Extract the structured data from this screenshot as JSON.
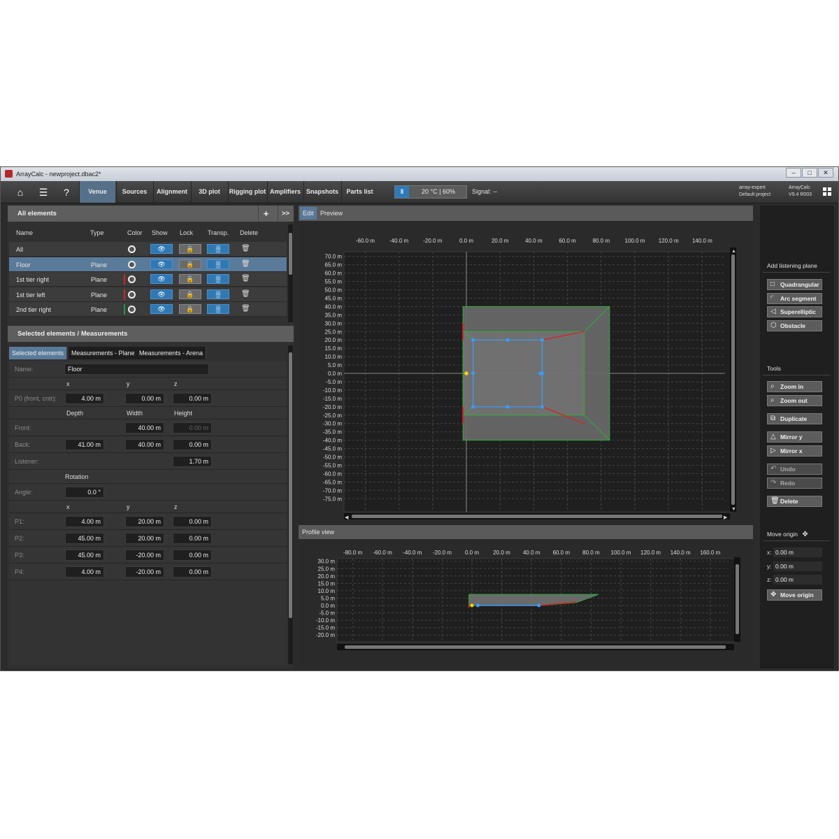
{
  "window": {
    "title": "ArrayCalc - newproject.dbac2*",
    "min": "–",
    "max": "□",
    "close": "✕"
  },
  "toolbar": {
    "tabs": [
      "Venue",
      "Sources",
      "Alignment",
      "3D plot",
      "Rigging plot",
      "Amplifiers",
      "Snapshots",
      "Parts list"
    ],
    "active_tab": "Venue",
    "temp_icon": "‖",
    "temp": "20 °C | 60%",
    "signal": "Signal: --",
    "expert_1": "array-expert",
    "expert_2": "Default project",
    "ver_1": "ArrayCalc",
    "ver_2": "V9.4 R003"
  },
  "all_elements": {
    "title": "All elements",
    "add": "+",
    "expand": ">>",
    "columns": [
      "Name",
      "Type",
      "Color",
      "Show",
      "Lock",
      "Transp.",
      "Delete"
    ],
    "rows": [
      {
        "name": "All",
        "type": "",
        "color": ""
      },
      {
        "name": "Floor",
        "type": "Plane",
        "color": ""
      },
      {
        "name": "1st tier right",
        "type": "Plane",
        "color": "#d0272b"
      },
      {
        "name": "1st tier left",
        "type": "Plane",
        "color": "#d0272b"
      },
      {
        "name": "2nd tier right",
        "type": "Plane",
        "color": "#1e9b3a"
      }
    ],
    "show_glyph": "👁",
    "lock_glyph": "🔒",
    "transp_glyph": "▒",
    "delete_glyph": "🗑"
  },
  "selected": {
    "title": "Selected elements / Measurements",
    "tabs": [
      "Selected elements",
      "Measurements - Plane",
      "Measurements - Arena"
    ],
    "name_label": "Name:",
    "name_value": "Floor",
    "h_x": "x",
    "h_y": "y",
    "h_z": "z",
    "p0_label": "P0 (front, cntr):",
    "p0": [
      "4.00 m",
      "0.00 m",
      "0.00 m"
    ],
    "h_depth": "Depth",
    "h_width": "Width",
    "h_height": "Height",
    "front_label": "Front:",
    "front": [
      "",
      "40.00 m",
      "0.00 m"
    ],
    "back_label": "Back:",
    "back": [
      "41.00 m",
      "40.00 m",
      "0.00 m"
    ],
    "listener_label": "Listener:",
    "listener": "1.70 m",
    "rotation": "Rotation",
    "angle_label": "Angle:",
    "angle": "0.0 °",
    "points": [
      {
        "label": "P1:",
        "v": [
          "4.00 m",
          "20.00 m",
          "0.00 m"
        ]
      },
      {
        "label": "P2:",
        "v": [
          "45.00 m",
          "20.00 m",
          "0.00 m"
        ]
      },
      {
        "label": "P3:",
        "v": [
          "45.00 m",
          "-20.00 m",
          "0.00 m"
        ]
      },
      {
        "label": "P4:",
        "v": [
          "4.00 m",
          "-20.00 m",
          "0.00 m"
        ]
      }
    ]
  },
  "center": {
    "tab_edit": "Edit",
    "tab_preview": "Preview",
    "profile_title": "Profile view",
    "top_x_ticks": [
      "-60.0 m",
      "-40.0 m",
      "-20.0 m",
      "0.0 m",
      "20.0 m",
      "40.0 m",
      "60.0 m",
      "80.0 m",
      "100.0 m",
      "120.0 m",
      "140.0 m"
    ],
    "top_y_ticks": [
      "70.0 m",
      "65.0 m",
      "60.0 m",
      "55.0 m",
      "50.0 m",
      "45.0 m",
      "40.0 m",
      "35.0 m",
      "30.0 m",
      "25.0 m",
      "20.0 m",
      "15.0 m",
      "10.0 m",
      "5.0 m",
      "0.0 m",
      "-5.0 m",
      "-10.0 m",
      "-15.0 m",
      "-20.0 m",
      "-25.0 m",
      "-30.0 m",
      "-35.0 m",
      "-40.0 m",
      "-45.0 m",
      "-50.0 m",
      "-55.0 m",
      "-60.0 m",
      "-65.0 m",
      "-70.0 m",
      "-75.0 m"
    ],
    "prof_x_ticks": [
      "-80.0 m",
      "-60.0 m",
      "-40.0 m",
      "-20.0 m",
      "0.0 m",
      "20.0 m",
      "40.0 m",
      "60.0 m",
      "80.0 m",
      "100.0 m",
      "120.0 m",
      "140.0 m",
      "160.0 m"
    ],
    "prof_y_ticks": [
      "30.0 m",
      "25.0 m",
      "20.0 m",
      "15.0 m",
      "10.0 m",
      "5.0 m",
      "0.0 m",
      "-5.0 m",
      "-10.0 m",
      "-15.0 m",
      "-20.0 m"
    ]
  },
  "right": {
    "add_plane": "Add listening plane",
    "plane_buttons": [
      {
        "label": "Quadrangular",
        "icon": "□"
      },
      {
        "label": "Arc segment",
        "icon": "◜"
      },
      {
        "label": "Superelliptic",
        "icon": "◁"
      },
      {
        "label": "Obstacle",
        "icon": "⬡"
      }
    ],
    "tools": "Tools",
    "tool_buttons": [
      {
        "label": "Zoom in",
        "icon": "⌕"
      },
      {
        "label": "Zoom out",
        "icon": "⌕"
      },
      {
        "label": "Duplicate",
        "icon": "⧉"
      },
      {
        "label": "Mirror y",
        "icon": "△"
      },
      {
        "label": "Mirror x",
        "icon": "▷"
      },
      {
        "label": "Undo",
        "icon": "↶"
      },
      {
        "label": "Redo",
        "icon": "↷"
      },
      {
        "label": "Delete",
        "icon": "🗑"
      }
    ],
    "move_origin": "Move origin",
    "move_origin_icon": "✥",
    "origin": [
      {
        "axis": "x:",
        "value": "0.00 m"
      },
      {
        "axis": "y:",
        "value": "0.00 m"
      },
      {
        "axis": "z:",
        "value": "0.00 m"
      }
    ],
    "move_origin_btn": "Move origin"
  },
  "colors": {
    "accent": "#2f78b4",
    "tab_active": "#56708a",
    "selection": "#5a7a99",
    "plane_green": "#2fae3a",
    "plane_red": "#d0272b",
    "handle_blue": "#3a9bff",
    "origin_yellow": "#ffd400"
  }
}
